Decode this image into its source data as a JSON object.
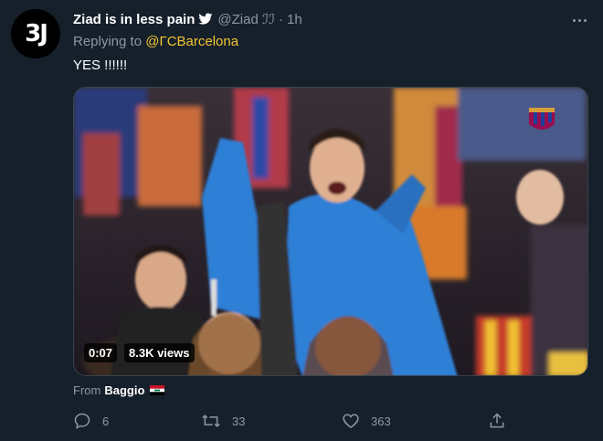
{
  "author": {
    "avatar_text": "3J",
    "display_name": "Ziad is in less pain",
    "handle": "@Ziad ℐℐ",
    "separator": "·",
    "time": "1h",
    "bird_icon": "twitter-bird-icon"
  },
  "reply": {
    "prefix": "Replying to",
    "handle": "@ΓCBarcelona"
  },
  "tweet": {
    "text": "YES !!!!!!"
  },
  "video": {
    "duration": "0:07",
    "views": "8.3K views"
  },
  "from": {
    "label": "From",
    "source": "Baggio",
    "flag_icon": "iraq-flag-icon"
  },
  "actions": {
    "replies": "6",
    "retweets": "33",
    "likes": "363"
  },
  "colors": {
    "background": "#15202b",
    "muted": "#8b98a5",
    "accent_handle": "#f4c430",
    "blaugrana_blue": "#1d3f9c",
    "blaugrana_red": "#a50044",
    "jacket_blue": "#2f7fd6"
  }
}
